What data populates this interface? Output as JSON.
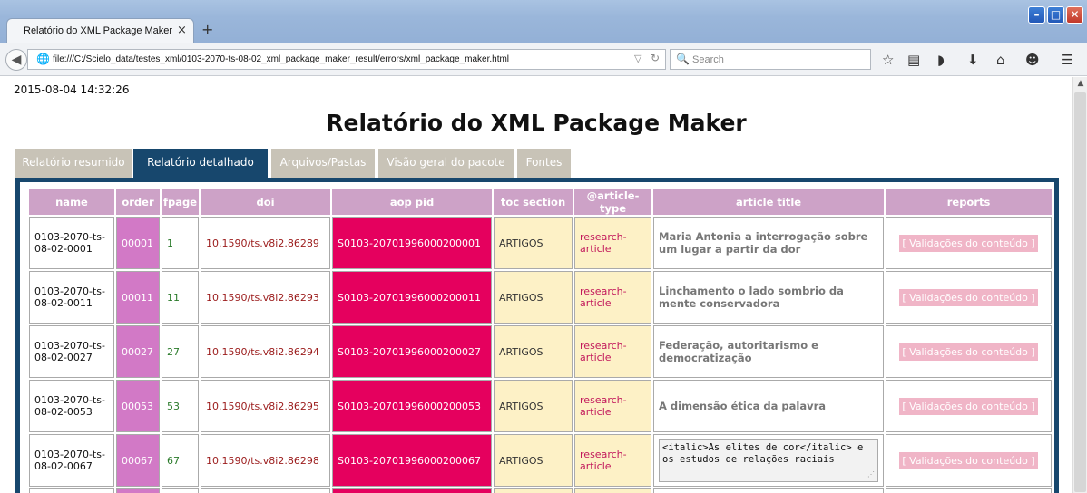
{
  "browser": {
    "tab_title": "Relatório do XML Package Maker",
    "tab_close": "×",
    "new_tab": "+",
    "url": "file:///C:/Scielo_data/testes_xml/0103-2070-ts-08-02_xml_package_maker_result/errors/xml_package_maker.html",
    "search_placeholder": "Search"
  },
  "page": {
    "timestamp": "2015-08-04 14:32:26",
    "title": "Relatório do XML Package Maker",
    "tabs": [
      {
        "label": "Relatório resumido",
        "active": false
      },
      {
        "label": "Relatório detalhado",
        "active": true
      },
      {
        "label": "Arquivos/Pastas",
        "active": false
      },
      {
        "label": "Visão geral do pacote",
        "active": false
      },
      {
        "label": "Fontes",
        "active": false
      }
    ]
  },
  "table": {
    "headers": [
      "name",
      "order",
      "fpage",
      "doi",
      "aop pid",
      "toc section",
      "@article-type",
      "article title",
      "reports"
    ],
    "rows": [
      {
        "name": "0103-2070-ts-08-02-0001",
        "order": "00001",
        "fpage": "1",
        "doi": "10.1590/ts.v8i2.86289",
        "aop_pid": "S0103-20701996000200001",
        "toc_section": "ARTIGOS",
        "article_type": "research-article",
        "title": "Maria Antonia a interrogação sobre um lugar a partir da dor",
        "raw": false,
        "report": "[ Validações do conteúdo ]"
      },
      {
        "name": "0103-2070-ts-08-02-0011",
        "order": "00011",
        "fpage": "11",
        "doi": "10.1590/ts.v8i2.86293",
        "aop_pid": "S0103-20701996000200011",
        "toc_section": "ARTIGOS",
        "article_type": "research-article",
        "title": "Linchamento o lado sombrio da mente conservadora",
        "raw": false,
        "report": "[ Validações do conteúdo ]"
      },
      {
        "name": "0103-2070-ts-08-02-0027",
        "order": "00027",
        "fpage": "27",
        "doi": "10.1590/ts.v8i2.86294",
        "aop_pid": "S0103-20701996000200027",
        "toc_section": "ARTIGOS",
        "article_type": "research-article",
        "title": "Federação, autoritarismo e democratização",
        "raw": false,
        "report": "[ Validações do conteúdo ]"
      },
      {
        "name": "0103-2070-ts-08-02-0053",
        "order": "00053",
        "fpage": "53",
        "doi": "10.1590/ts.v8i2.86295",
        "aop_pid": "S0103-20701996000200053",
        "toc_section": "ARTIGOS",
        "article_type": "research-article",
        "title": "A dimensão ética da palavra",
        "raw": false,
        "report": "[ Validações do conteúdo ]"
      },
      {
        "name": "0103-2070-ts-08-02-0067",
        "order": "00067",
        "fpage": "67",
        "doi": "10.1590/ts.v8i2.86298",
        "aop_pid": "S0103-20701996000200067",
        "toc_section": "ARTIGOS",
        "article_type": "research-article",
        "title": "<italic>As elites de cor</italic> e os estudos de relações raciais",
        "raw": true,
        "report": "[ Validações do conteúdo ]"
      }
    ]
  },
  "icons": [
    "back-icon",
    "globe-icon",
    "reload-icon",
    "search-icon",
    "bookmark-star-icon",
    "reading-list-icon",
    "pocket-icon",
    "download-icon",
    "home-icon",
    "chat-icon",
    "menu-icon"
  ]
}
